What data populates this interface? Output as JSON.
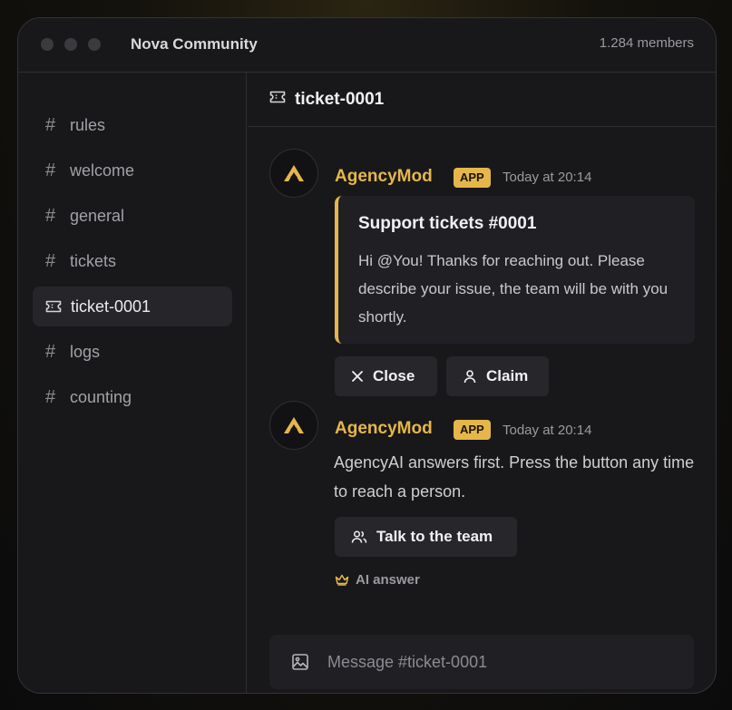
{
  "window": {
    "server_name": "Nova Community",
    "members": "1.284 members"
  },
  "sidebar": {
    "channels": [
      {
        "label": "rules",
        "icon": "hash-icon"
      },
      {
        "label": "welcome",
        "icon": "hash-icon"
      },
      {
        "label": "general",
        "icon": "hash-icon"
      },
      {
        "label": "tickets",
        "icon": "hash-icon"
      },
      {
        "label": "ticket-0001",
        "icon": "ticket-icon",
        "active": true
      },
      {
        "label": "logs",
        "icon": "hash-icon"
      },
      {
        "label": "counting",
        "icon": "hash-icon"
      }
    ]
  },
  "channel_header": {
    "title": "ticket-0001",
    "icon": "ticket-icon"
  },
  "messages": [
    {
      "author": "AgencyMod",
      "badge": "APP",
      "time": "Today at 20:14",
      "embed": {
        "title": "Support tickets #0001",
        "body": "Hi @You! Thanks for reaching out. Please describe your issue, the team will be with you shortly."
      },
      "buttons": [
        {
          "label": "Close",
          "icon": "close-icon"
        },
        {
          "label": "Claim",
          "icon": "user-icon"
        }
      ]
    },
    {
      "author": "AgencyMod",
      "badge": "APP",
      "time": "Today at 20:14",
      "text": "AgencyAI answers first. Press the button any time to reach a person.",
      "buttons": [
        {
          "label": "Talk to the team",
          "icon": "users-icon"
        }
      ],
      "note": "AI answer",
      "note_icon": "crown-icon"
    }
  ],
  "composer": {
    "placeholder": "Message #ticket-0001",
    "icon": "image-icon"
  },
  "colors": {
    "accent": "#e5b74a",
    "background": "#18181b",
    "surface": "#202024"
  }
}
